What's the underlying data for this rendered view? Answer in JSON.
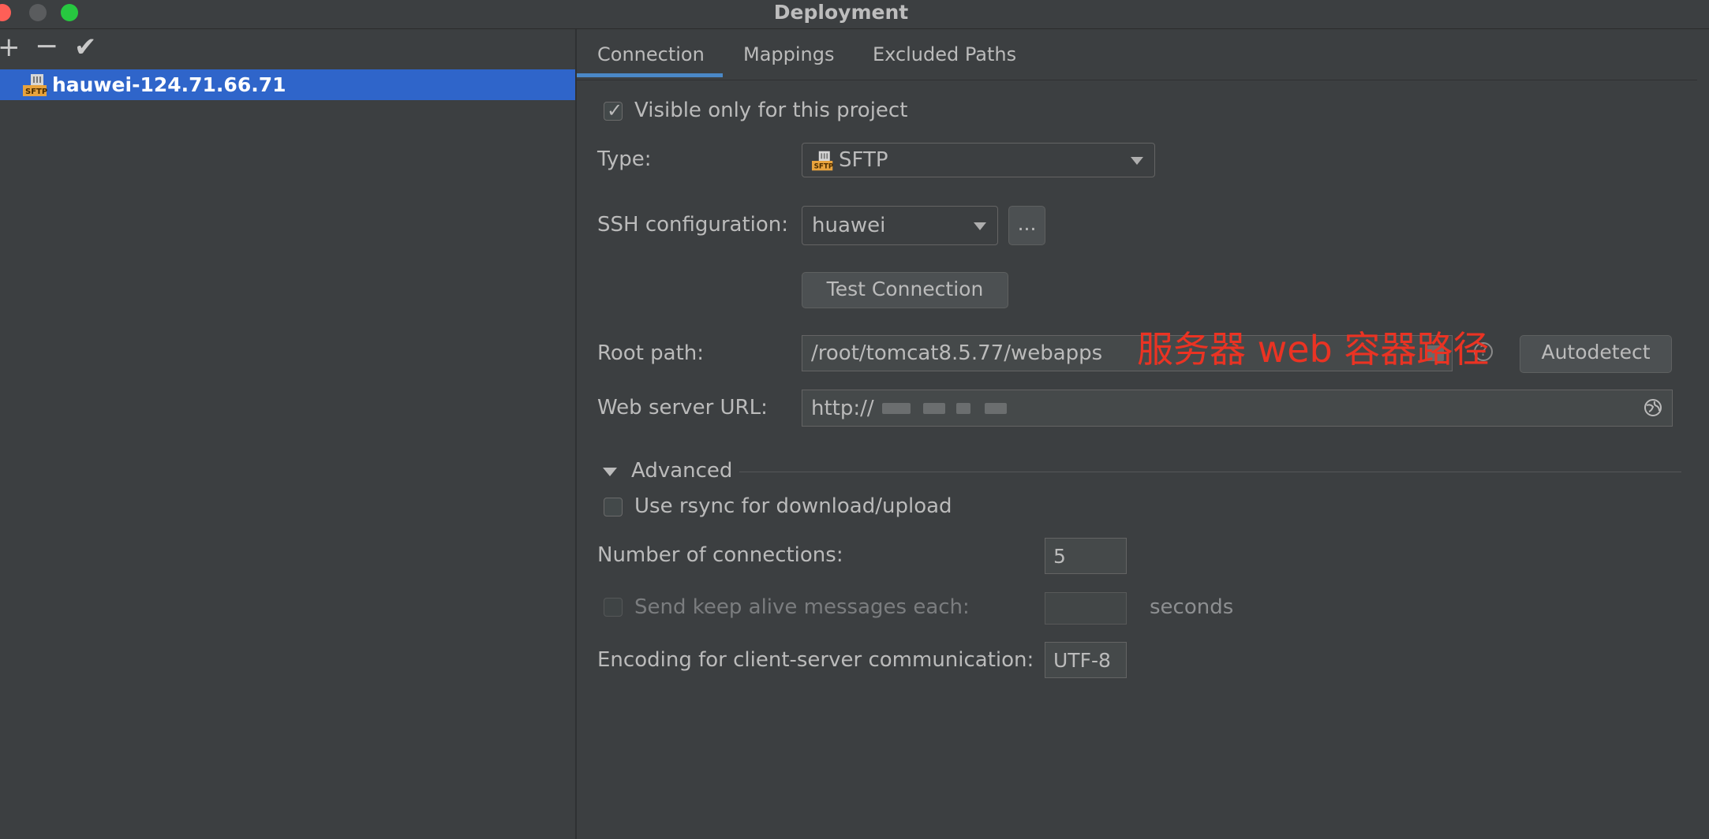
{
  "window": {
    "title": "Deployment"
  },
  "toolbar": {
    "add": "+",
    "remove": "−",
    "apply": "✔"
  },
  "servers": [
    {
      "label": "hauwei-124.71.66.71",
      "icon": "sftp-server-icon"
    }
  ],
  "tabs": [
    {
      "label": "Connection"
    },
    {
      "label": "Mappings"
    },
    {
      "label": "Excluded Paths"
    }
  ],
  "connection": {
    "visible_only_label": "Visible only for this project",
    "type_label": "Type:",
    "type_value": "SFTP",
    "ssh_label": "SSH configuration:",
    "ssh_value": "huawei",
    "ssh_more": "...",
    "test_connection": "Test Connection",
    "root_path_label": "Root path:",
    "root_path_value": "/root/tomcat8.5.77/webapps",
    "autodetect": "Autodetect",
    "help": "?",
    "web_url_label": "Web server URL:",
    "web_url_value": "http://",
    "annotation": "服务器 web 容器路径"
  },
  "advanced": {
    "section_label": "Advanced",
    "rsync_label": "Use rsync for download/upload",
    "connections_label": "Number of connections:",
    "connections_value": "5",
    "keepalive_label": "Send keep alive messages each:",
    "keepalive_unit": "seconds",
    "encoding_label": "Encoding for client-server communication:",
    "encoding_value": "UTF-8"
  },
  "colors": {
    "accent": "#2f65ca",
    "tab_underline": "#4a88c7",
    "annotation": "#ea3323",
    "background": "#3c3f41"
  }
}
